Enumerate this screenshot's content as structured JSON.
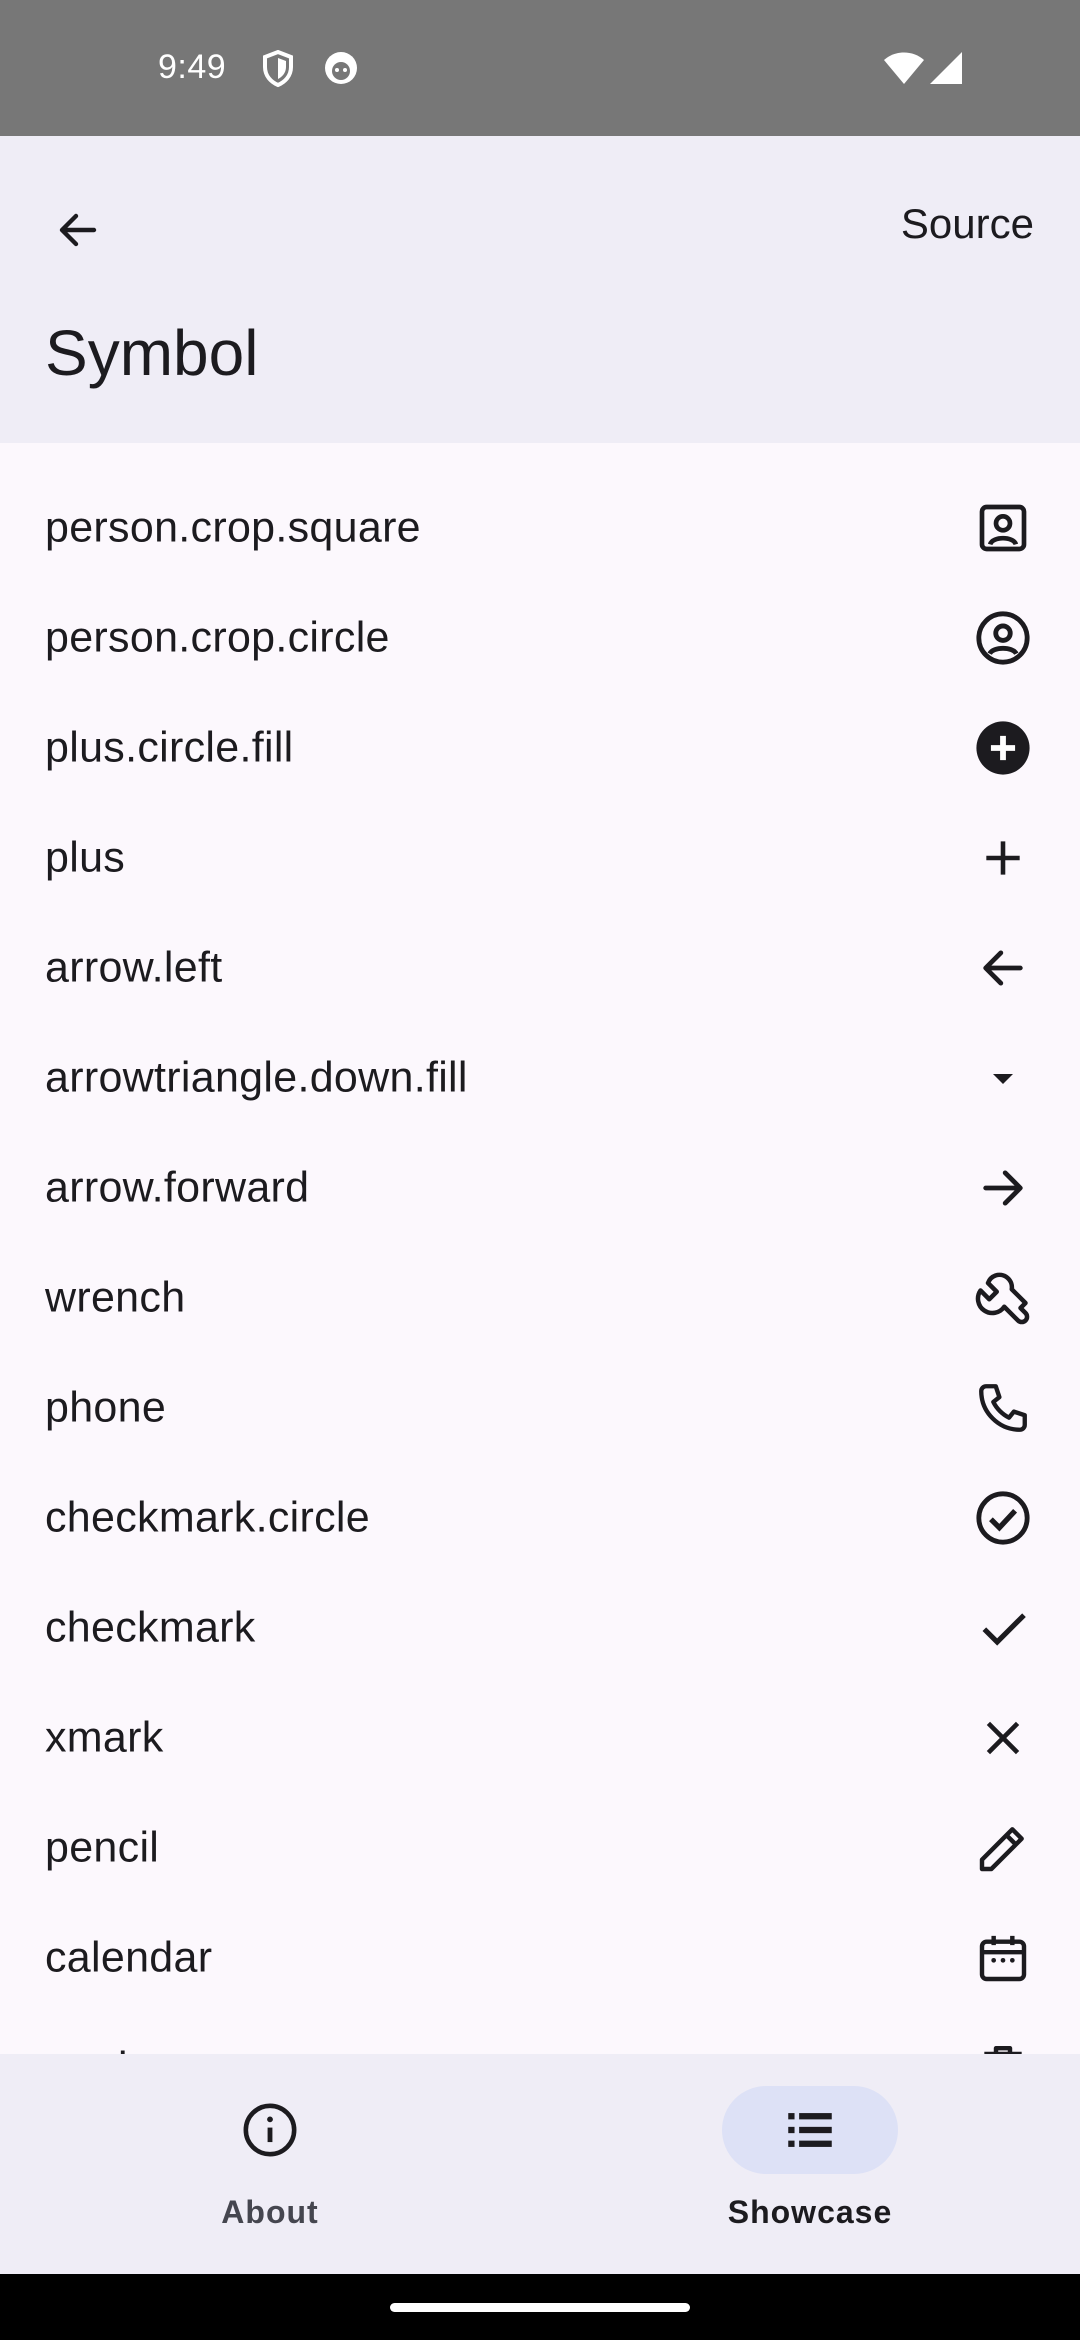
{
  "status_bar": {
    "time": "9:49"
  },
  "top_bar": {
    "source_label": "Source",
    "title": "Symbol"
  },
  "symbols": [
    {
      "label": "person.crop.square",
      "icon": "person-crop-square-icon"
    },
    {
      "label": "person.crop.circle",
      "icon": "person-crop-circle-icon"
    },
    {
      "label": "plus.circle.fill",
      "icon": "plus-circle-fill-icon"
    },
    {
      "label": "plus",
      "icon": "plus-icon"
    },
    {
      "label": "arrow.left",
      "icon": "arrow-left-icon"
    },
    {
      "label": "arrowtriangle.down.fill",
      "icon": "arrowtriangle-down-fill-icon"
    },
    {
      "label": "arrow.forward",
      "icon": "arrow-forward-icon"
    },
    {
      "label": "wrench",
      "icon": "wrench-icon"
    },
    {
      "label": "phone",
      "icon": "phone-icon"
    },
    {
      "label": "checkmark.circle",
      "icon": "checkmark-circle-icon"
    },
    {
      "label": "checkmark",
      "icon": "checkmark-icon"
    },
    {
      "label": "xmark",
      "icon": "xmark-icon"
    },
    {
      "label": "pencil",
      "icon": "pencil-icon"
    },
    {
      "label": "calendar",
      "icon": "calendar-icon"
    },
    {
      "label": "trash",
      "icon": "trash-icon"
    }
  ],
  "bottom_nav": {
    "items": [
      {
        "label": "About",
        "icon": "info-icon",
        "selected": false
      },
      {
        "label": "Showcase",
        "icon": "list-icon",
        "selected": true
      }
    ]
  },
  "colors": {
    "background": "#fcf8fd",
    "bar_background": "#efedf6",
    "selected_pill": "#dde1f6",
    "text": "#1c1b1f",
    "status_bar": "#777777"
  }
}
